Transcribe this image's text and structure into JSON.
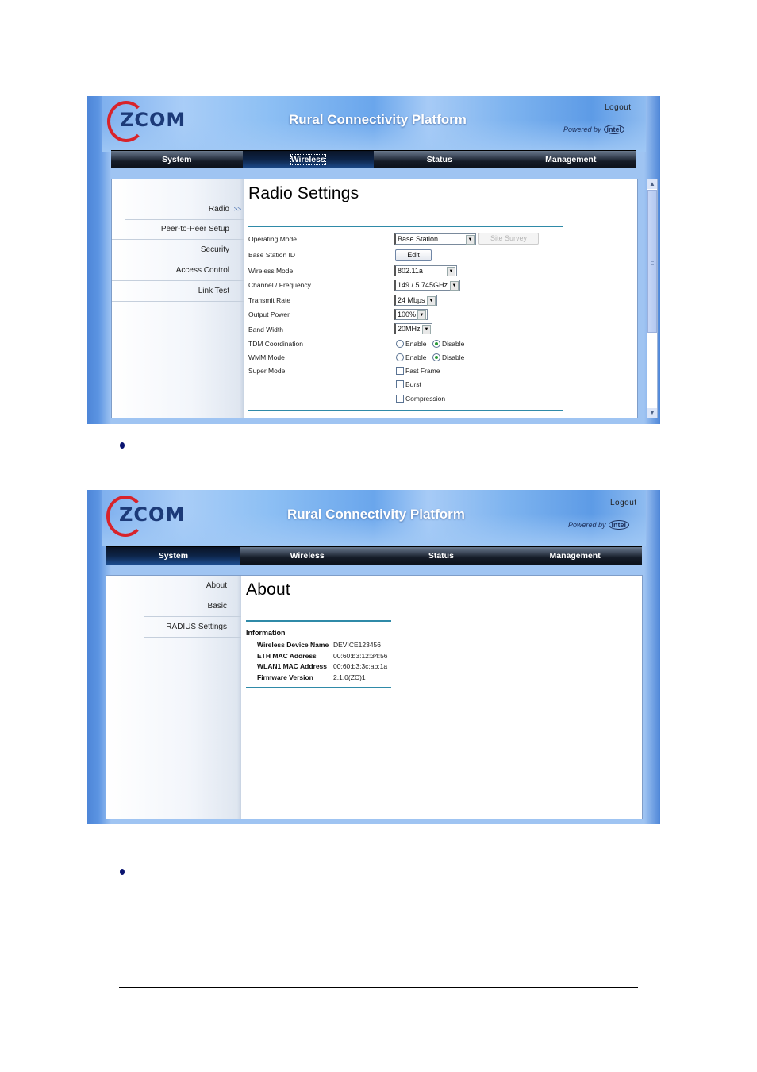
{
  "document": {
    "bullets": [
      "",
      ""
    ]
  },
  "screens": [
    {
      "app_title": "Rural Connectivity Platform",
      "brand": "ZCOM",
      "logout": "Logout",
      "powered_by": "Powered by",
      "intel": "intel",
      "nav": [
        {
          "label": "System",
          "active": false
        },
        {
          "label": "Wireless",
          "active": true
        },
        {
          "label": "Status",
          "active": false
        },
        {
          "label": "Management",
          "active": false
        }
      ],
      "sidebar": [
        {
          "label": "Radio",
          "current": true
        },
        {
          "label": "Peer-to-Peer Setup",
          "current": false
        },
        {
          "label": "Security",
          "current": false
        },
        {
          "label": "Access Control",
          "current": false
        },
        {
          "label": "Link Test",
          "current": false
        }
      ],
      "current_arrow": ">>",
      "page_title": "Radio Settings",
      "fields": {
        "operating_mode": {
          "label": "Operating Mode",
          "value": "Base Station",
          "button": "Site Survey"
        },
        "base_station_id": {
          "label": "Base Station ID",
          "button": "Edit"
        },
        "wireless_mode": {
          "label": "Wireless Mode",
          "value": "802.11a"
        },
        "channel": {
          "label": "Channel / Frequency",
          "value": "149 / 5.745GHz"
        },
        "transmit_rate": {
          "label": "Transmit Rate",
          "value": "24 Mbps"
        },
        "output_power": {
          "label": "Output Power",
          "value": "100%"
        },
        "band_width": {
          "label": "Band Width",
          "value": "20MHz"
        },
        "tdm": {
          "label": "TDM Coordination",
          "options": [
            "Enable",
            "Disable"
          ],
          "selected": "Disable"
        },
        "wmm": {
          "label": "WMM Mode",
          "options": [
            "Enable",
            "Disable"
          ],
          "selected": "Disable"
        },
        "super_mode": {
          "label": "Super Mode",
          "options": [
            {
              "label": "Fast Frame",
              "checked": false
            },
            {
              "label": "Burst",
              "checked": false
            },
            {
              "label": "Compression",
              "checked": false
            }
          ]
        }
      },
      "scrollbar": {
        "position_fraction": 0.0,
        "visible_fraction": 0.7
      }
    },
    {
      "app_title": "Rural Connectivity Platform",
      "brand": "ZCOM",
      "logout": "Logout",
      "powered_by": "Powered by",
      "intel": "intel",
      "nav": [
        {
          "label": "System",
          "active": true
        },
        {
          "label": "Wireless",
          "active": false
        },
        {
          "label": "Status",
          "active": false
        },
        {
          "label": "Management",
          "active": false
        }
      ],
      "sidebar": [
        {
          "label": "About",
          "current": true
        },
        {
          "label": "Basic",
          "current": false
        },
        {
          "label": "RADIUS Settings",
          "current": false
        }
      ],
      "page_title": "About",
      "info": {
        "heading": "Information",
        "rows": [
          {
            "key": "Wireless Device Name",
            "value": "DEVICE123456"
          },
          {
            "key": "ETH MAC Address",
            "value": "00:60:b3:12:34:56"
          },
          {
            "key": "WLAN1 MAC Address",
            "value": "00:60:b3:3c:ab:1a"
          },
          {
            "key": "Firmware Version",
            "value": "2.1.0(ZC)1"
          }
        ]
      }
    }
  ]
}
